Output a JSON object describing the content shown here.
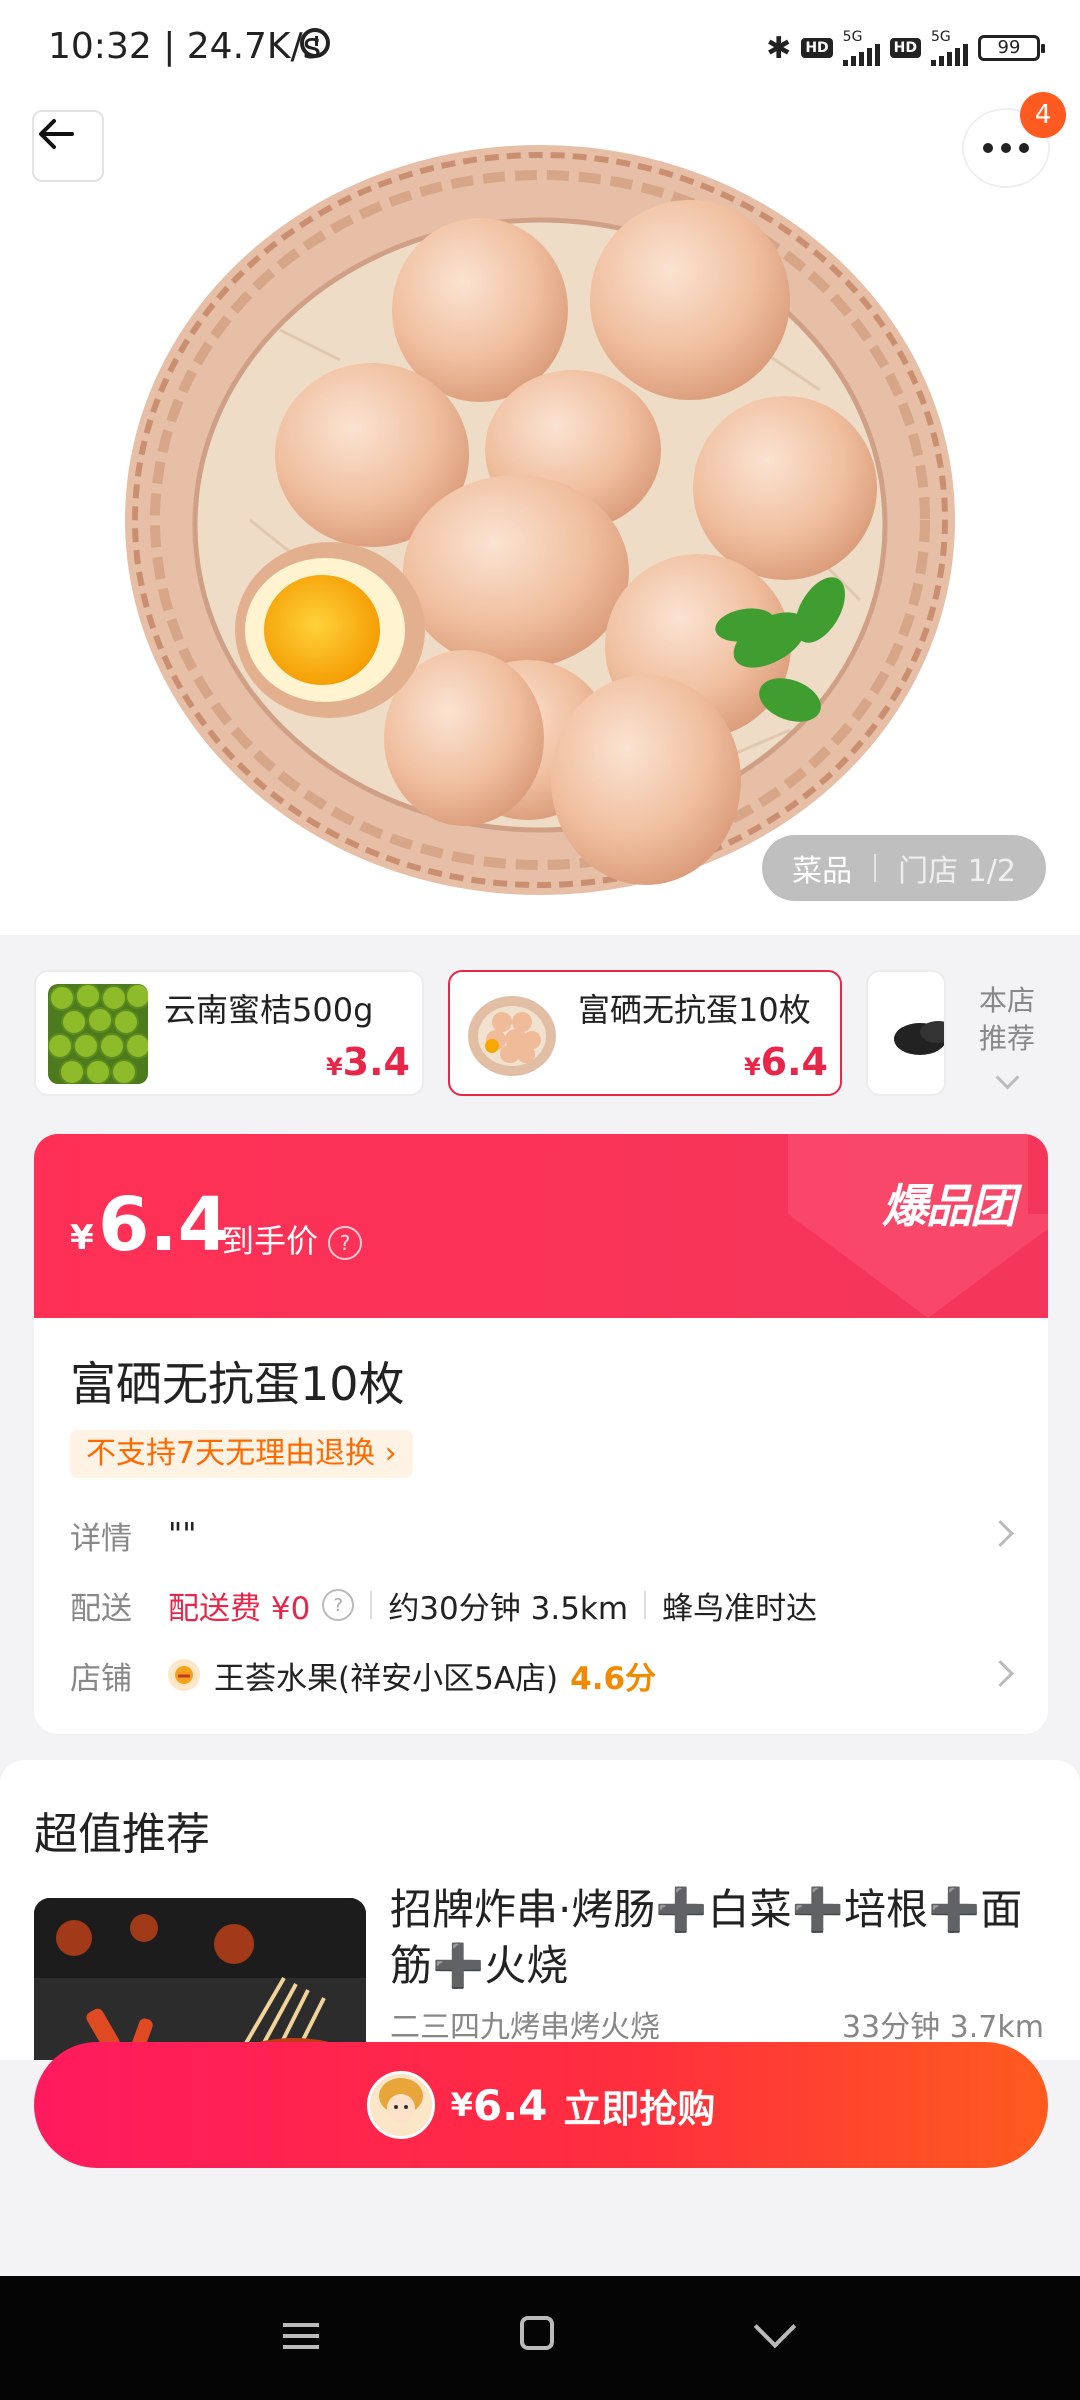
{
  "status_bar": {
    "time": "10:32 | 24.7K/s",
    "hd1": "HD",
    "net1": "5G",
    "hd2": "HD",
    "net2": "5G",
    "battery": "99"
  },
  "header": {
    "more_badge": "4"
  },
  "image_tabs": {
    "dishes": "菜品",
    "store": "门店 1/2"
  },
  "related_products": [
    {
      "name": "云南蜜桔500g",
      "price_symbol": "¥",
      "price": "3.4"
    },
    {
      "name": "富硒无抗蛋10枚",
      "price_symbol": "¥",
      "price": "6.4"
    }
  ],
  "store_recommend_label": "本店推荐",
  "price_banner": {
    "symbol": "¥",
    "price": "6.4",
    "label": "到手价",
    "help": "?",
    "logo": "爆品团"
  },
  "product": {
    "title": "富硒无抗蛋10枚",
    "policy": "不支持7天无理由退换 ›",
    "details_label": "详情",
    "details_value": "\"\"",
    "delivery_label": "配送",
    "delivery_fee": "配送费 ¥0",
    "delivery_help": "?",
    "delivery_time": "约30分钟 3.5km",
    "delivery_service": "蜂鸟准时达",
    "store_label": "店铺",
    "store_name": "王荟水果(祥安小区5A店)",
    "store_rating": "4.6分"
  },
  "recommendations": {
    "title": "超值推荐",
    "items": [
      {
        "name": "招牌炸串·烤肠➕白菜➕培根➕面筋➕火烧",
        "shop": "二三四九烤串烤火烧",
        "distance": "33分钟 3.7km"
      }
    ]
  },
  "buy_button": {
    "symbol": "¥",
    "price": "6.4",
    "label": "立即抢购"
  },
  "colors": {
    "accent": "#e8264a",
    "orange": "#f18a00",
    "nav_bg": "#050505"
  }
}
